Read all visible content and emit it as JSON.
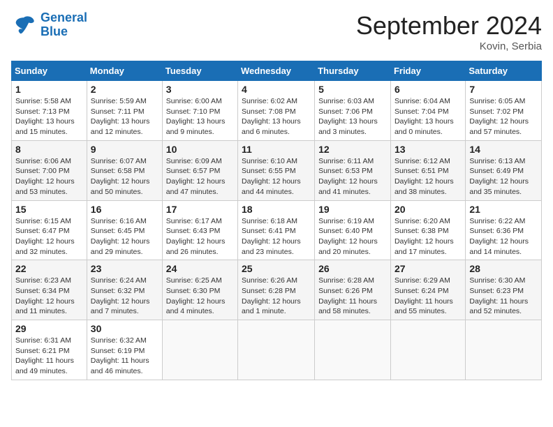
{
  "header": {
    "logo_line1": "General",
    "logo_line2": "Blue",
    "month": "September 2024",
    "location": "Kovin, Serbia"
  },
  "weekdays": [
    "Sunday",
    "Monday",
    "Tuesday",
    "Wednesday",
    "Thursday",
    "Friday",
    "Saturday"
  ],
  "weeks": [
    [
      {
        "day": "1",
        "lines": [
          "Sunrise: 5:58 AM",
          "Sunset: 7:13 PM",
          "Daylight: 13 hours",
          "and 15 minutes."
        ]
      },
      {
        "day": "2",
        "lines": [
          "Sunrise: 5:59 AM",
          "Sunset: 7:11 PM",
          "Daylight: 13 hours",
          "and 12 minutes."
        ]
      },
      {
        "day": "3",
        "lines": [
          "Sunrise: 6:00 AM",
          "Sunset: 7:10 PM",
          "Daylight: 13 hours",
          "and 9 minutes."
        ]
      },
      {
        "day": "4",
        "lines": [
          "Sunrise: 6:02 AM",
          "Sunset: 7:08 PM",
          "Daylight: 13 hours",
          "and 6 minutes."
        ]
      },
      {
        "day": "5",
        "lines": [
          "Sunrise: 6:03 AM",
          "Sunset: 7:06 PM",
          "Daylight: 13 hours",
          "and 3 minutes."
        ]
      },
      {
        "day": "6",
        "lines": [
          "Sunrise: 6:04 AM",
          "Sunset: 7:04 PM",
          "Daylight: 13 hours",
          "and 0 minutes."
        ]
      },
      {
        "day": "7",
        "lines": [
          "Sunrise: 6:05 AM",
          "Sunset: 7:02 PM",
          "Daylight: 12 hours",
          "and 57 minutes."
        ]
      }
    ],
    [
      {
        "day": "8",
        "lines": [
          "Sunrise: 6:06 AM",
          "Sunset: 7:00 PM",
          "Daylight: 12 hours",
          "and 53 minutes."
        ]
      },
      {
        "day": "9",
        "lines": [
          "Sunrise: 6:07 AM",
          "Sunset: 6:58 PM",
          "Daylight: 12 hours",
          "and 50 minutes."
        ]
      },
      {
        "day": "10",
        "lines": [
          "Sunrise: 6:09 AM",
          "Sunset: 6:57 PM",
          "Daylight: 12 hours",
          "and 47 minutes."
        ]
      },
      {
        "day": "11",
        "lines": [
          "Sunrise: 6:10 AM",
          "Sunset: 6:55 PM",
          "Daylight: 12 hours",
          "and 44 minutes."
        ]
      },
      {
        "day": "12",
        "lines": [
          "Sunrise: 6:11 AM",
          "Sunset: 6:53 PM",
          "Daylight: 12 hours",
          "and 41 minutes."
        ]
      },
      {
        "day": "13",
        "lines": [
          "Sunrise: 6:12 AM",
          "Sunset: 6:51 PM",
          "Daylight: 12 hours",
          "and 38 minutes."
        ]
      },
      {
        "day": "14",
        "lines": [
          "Sunrise: 6:13 AM",
          "Sunset: 6:49 PM",
          "Daylight: 12 hours",
          "and 35 minutes."
        ]
      }
    ],
    [
      {
        "day": "15",
        "lines": [
          "Sunrise: 6:15 AM",
          "Sunset: 6:47 PM",
          "Daylight: 12 hours",
          "and 32 minutes."
        ]
      },
      {
        "day": "16",
        "lines": [
          "Sunrise: 6:16 AM",
          "Sunset: 6:45 PM",
          "Daylight: 12 hours",
          "and 29 minutes."
        ]
      },
      {
        "day": "17",
        "lines": [
          "Sunrise: 6:17 AM",
          "Sunset: 6:43 PM",
          "Daylight: 12 hours",
          "and 26 minutes."
        ]
      },
      {
        "day": "18",
        "lines": [
          "Sunrise: 6:18 AM",
          "Sunset: 6:41 PM",
          "Daylight: 12 hours",
          "and 23 minutes."
        ]
      },
      {
        "day": "19",
        "lines": [
          "Sunrise: 6:19 AM",
          "Sunset: 6:40 PM",
          "Daylight: 12 hours",
          "and 20 minutes."
        ]
      },
      {
        "day": "20",
        "lines": [
          "Sunrise: 6:20 AM",
          "Sunset: 6:38 PM",
          "Daylight: 12 hours",
          "and 17 minutes."
        ]
      },
      {
        "day": "21",
        "lines": [
          "Sunrise: 6:22 AM",
          "Sunset: 6:36 PM",
          "Daylight: 12 hours",
          "and 14 minutes."
        ]
      }
    ],
    [
      {
        "day": "22",
        "lines": [
          "Sunrise: 6:23 AM",
          "Sunset: 6:34 PM",
          "Daylight: 12 hours",
          "and 11 minutes."
        ]
      },
      {
        "day": "23",
        "lines": [
          "Sunrise: 6:24 AM",
          "Sunset: 6:32 PM",
          "Daylight: 12 hours",
          "and 7 minutes."
        ]
      },
      {
        "day": "24",
        "lines": [
          "Sunrise: 6:25 AM",
          "Sunset: 6:30 PM",
          "Daylight: 12 hours",
          "and 4 minutes."
        ]
      },
      {
        "day": "25",
        "lines": [
          "Sunrise: 6:26 AM",
          "Sunset: 6:28 PM",
          "Daylight: 12 hours",
          "and 1 minute."
        ]
      },
      {
        "day": "26",
        "lines": [
          "Sunrise: 6:28 AM",
          "Sunset: 6:26 PM",
          "Daylight: 11 hours",
          "and 58 minutes."
        ]
      },
      {
        "day": "27",
        "lines": [
          "Sunrise: 6:29 AM",
          "Sunset: 6:24 PM",
          "Daylight: 11 hours",
          "and 55 minutes."
        ]
      },
      {
        "day": "28",
        "lines": [
          "Sunrise: 6:30 AM",
          "Sunset: 6:23 PM",
          "Daylight: 11 hours",
          "and 52 minutes."
        ]
      }
    ],
    [
      {
        "day": "29",
        "lines": [
          "Sunrise: 6:31 AM",
          "Sunset: 6:21 PM",
          "Daylight: 11 hours",
          "and 49 minutes."
        ]
      },
      {
        "day": "30",
        "lines": [
          "Sunrise: 6:32 AM",
          "Sunset: 6:19 PM",
          "Daylight: 11 hours",
          "and 46 minutes."
        ]
      },
      null,
      null,
      null,
      null,
      null
    ]
  ]
}
